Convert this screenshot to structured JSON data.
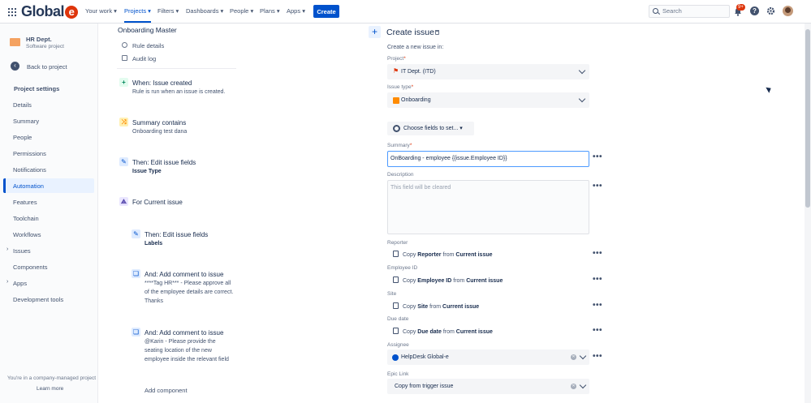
{
  "nav": {
    "logo_text": "Global",
    "logo_e": "e",
    "items": [
      "Your work",
      "Projects",
      "Filters",
      "Dashboards",
      "People",
      "Plans",
      "Apps"
    ],
    "create_label": "Create",
    "search_placeholder": "Search",
    "notifications_badge": "9+",
    "help_label": "?"
  },
  "sidebar": {
    "project_name": "HR Dept.",
    "project_type": "Software project",
    "back_label": "Back to project",
    "heading": "Project settings",
    "items": [
      "Details",
      "Summary",
      "People",
      "Permissions",
      "Notifications",
      "Automation",
      "Features",
      "Toolchain",
      "Workflows",
      "Issues",
      "Components",
      "Apps",
      "Development tools"
    ],
    "active_item": "Automation",
    "footer_text": "You're in a company-managed project",
    "learn_more": "Learn more"
  },
  "rule": {
    "title": "Onboarding Master",
    "links": [
      "Rule details",
      "Audit log"
    ],
    "steps": [
      {
        "title": "When: Issue created",
        "lines": [
          "Rule is run when an issue is created."
        ],
        "icon": "+"
      },
      {
        "title": "Summary contains",
        "lines": [
          "Onboarding test dana"
        ],
        "icon": "⤨"
      },
      {
        "title": "Then: Edit issue fields",
        "lines": [
          "Issue Type"
        ],
        "icon": "✎"
      },
      {
        "title": "For Current issue",
        "lines": [],
        "icon": "⟁"
      },
      {
        "title": "Then: Edit issue fields",
        "lines": [
          "Labels"
        ],
        "icon": "✎"
      },
      {
        "title": "And: Add comment to issue",
        "lines": [
          "****Tag HR*** - Please approve all",
          "of the employee details are correct.",
          "Thanks"
        ],
        "icon": "❏"
      },
      {
        "title": "And: Add comment to issue",
        "lines": [
          "@Karin - Please provide the",
          "seating location of the new",
          "employee inside the relevant field"
        ],
        "icon": "❏"
      }
    ],
    "add_component": "Add component"
  },
  "create_issue": {
    "title": "Create issue",
    "subtitle": "Create a new issue in:",
    "project_label": "Project",
    "project_value": "IT Dept. (ITD)",
    "issue_type_label": "Issue type",
    "issue_type_value": "Onboarding",
    "choose_fields": "Choose fields to set...",
    "summary_label": "Summary",
    "summary_value": "OnBoarding - employee {{issue.Employee ID}}",
    "description_label": "Description",
    "description_placeholder": "This field will be cleared",
    "copy_fields": [
      {
        "label": "Reporter",
        "field": "Reporter",
        "source": "Current issue"
      },
      {
        "label": "Employee ID",
        "field": "Employee ID",
        "source": "Current issue"
      },
      {
        "label": "Site",
        "field": "Site",
        "source": "Current issue"
      },
      {
        "label": "Due date",
        "field": "Due date",
        "source": "Current issue"
      }
    ],
    "copy_word": "Copy",
    "from_word": "from",
    "assignee_label": "Assignee",
    "assignee_value": "HelpDesk Global-e",
    "epic_label": "Epic Link",
    "epic_value": "Copy from trigger issue",
    "more_label": "•••",
    "required_mark": "*"
  },
  "colors": {
    "primary": "#0052cc",
    "logo_red": "#de350b",
    "onboarding_icon": "#ff8b00",
    "project_icon": "#de350b"
  }
}
